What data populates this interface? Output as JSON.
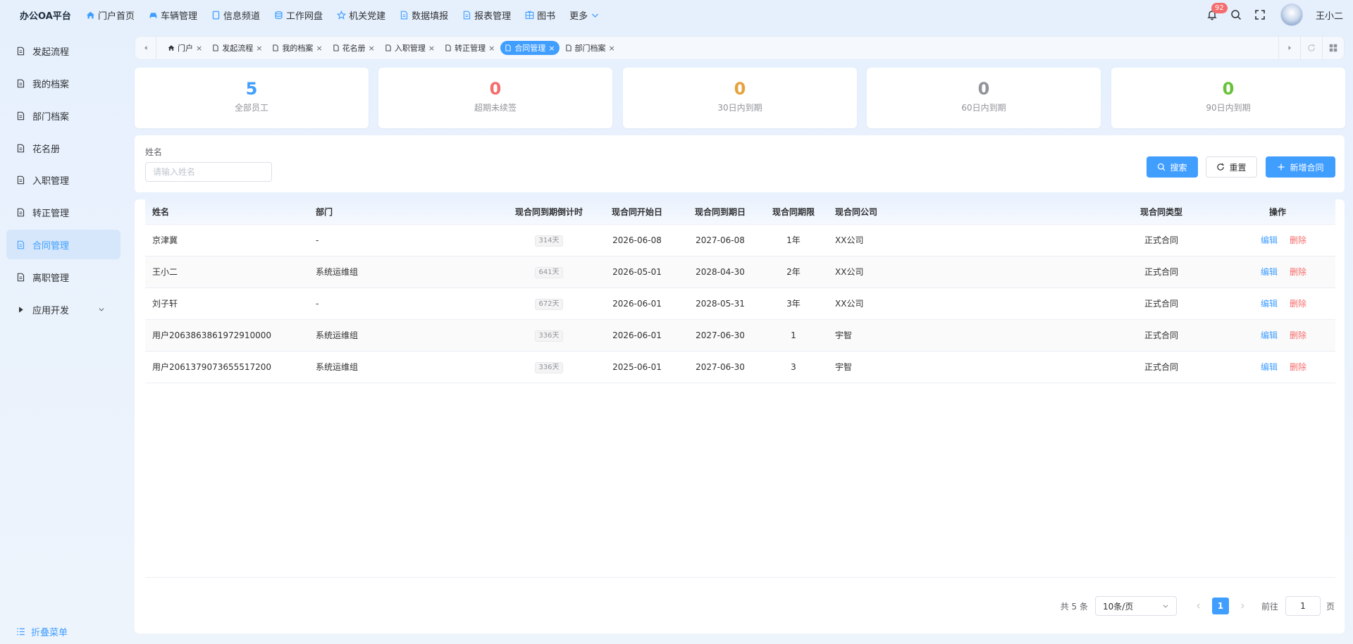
{
  "app": {
    "title": "办公OA平台"
  },
  "topnav": [
    {
      "label": "门户首页",
      "icon": "home-icon"
    },
    {
      "label": "车辆管理",
      "icon": "car-icon"
    },
    {
      "label": "信息频道",
      "icon": "tablet-icon"
    },
    {
      "label": "工作网盘",
      "icon": "database-icon"
    },
    {
      "label": "机关党建",
      "icon": "star-icon"
    },
    {
      "label": "数据填报",
      "icon": "document-icon"
    },
    {
      "label": "报表管理",
      "icon": "document-icon"
    },
    {
      "label": "图书",
      "icon": "grid-icon"
    },
    {
      "label": "更多",
      "icon": "chevron-down-icon"
    }
  ],
  "header": {
    "notification_count": "92",
    "username": "王小二"
  },
  "sidebar": {
    "items": [
      {
        "label": "发起流程",
        "icon": "document-icon"
      },
      {
        "label": "我的档案",
        "icon": "document-icon"
      },
      {
        "label": "部门档案",
        "icon": "document-icon"
      },
      {
        "label": "花名册",
        "icon": "document-icon"
      },
      {
        "label": "入职管理",
        "icon": "document-icon"
      },
      {
        "label": "转正管理",
        "icon": "document-icon"
      },
      {
        "label": "合同管理",
        "icon": "document-icon",
        "active": true
      },
      {
        "label": "离职管理",
        "icon": "document-icon"
      },
      {
        "label": "应用开发",
        "icon": "caret-right-icon"
      }
    ],
    "collapse_label": "折叠菜单"
  },
  "tabs": [
    {
      "label": "门户",
      "icon": "home-icon"
    },
    {
      "label": "发起流程",
      "icon": "document-icon"
    },
    {
      "label": "我的档案",
      "icon": "document-icon"
    },
    {
      "label": "花名册",
      "icon": "document-icon"
    },
    {
      "label": "入职管理",
      "icon": "document-icon"
    },
    {
      "label": "转正管理",
      "icon": "document-icon"
    },
    {
      "label": "合同管理",
      "icon": "document-icon",
      "active": true
    },
    {
      "label": "部门档案",
      "icon": "document-icon"
    }
  ],
  "stats": [
    {
      "value": "5",
      "label": "全部员工",
      "color": "#409eff"
    },
    {
      "value": "0",
      "label": "超期未续签",
      "color": "#f56c6c"
    },
    {
      "value": "0",
      "label": "30日内到期",
      "color": "#e6a23c"
    },
    {
      "value": "0",
      "label": "60日内到期",
      "color": "#909399"
    },
    {
      "value": "0",
      "label": "90日内到期",
      "color": "#67c23a"
    }
  ],
  "search": {
    "name_label": "姓名",
    "name_placeholder": "请输入姓名",
    "search_button": "搜索",
    "reset_button": "重置",
    "add_button": "新增合同"
  },
  "table": {
    "columns": [
      "姓名",
      "部门",
      "现合同到期倒计时",
      "现合同开始日",
      "现合同到期日",
      "现合同期限",
      "现合同公司",
      "现合同类型",
      "操作"
    ],
    "rows": [
      {
        "name": "京津冀",
        "dept": "-",
        "countdown": "314天",
        "start": "2026-06-08",
        "end": "2027-06-08",
        "term": "1年",
        "company": "XX公司",
        "type": "正式合同"
      },
      {
        "name": "王小二",
        "dept": "系统运维组",
        "countdown": "641天",
        "start": "2026-05-01",
        "end": "2028-04-30",
        "term": "2年",
        "company": "XX公司",
        "type": "正式合同"
      },
      {
        "name": "刘子轩",
        "dept": "-",
        "countdown": "672天",
        "start": "2026-06-01",
        "end": "2028-05-31",
        "term": "3年",
        "company": "XX公司",
        "type": "正式合同"
      },
      {
        "name": "用户2063863861972910000",
        "dept": "系统运维组",
        "countdown": "336天",
        "start": "2026-06-01",
        "end": "2027-06-30",
        "term": "1",
        "company": "宇智",
        "type": "正式合同"
      },
      {
        "name": "用户2061379073655517200",
        "dept": "系统运维组",
        "countdown": "336天",
        "start": "2025-06-01",
        "end": "2027-06-30",
        "term": "3",
        "company": "宇智",
        "type": "正式合同"
      }
    ],
    "edit_label": "编辑",
    "delete_label": "删除"
  },
  "pagination": {
    "total": "共 5 条",
    "page_size": "10条/页",
    "current_page": "1",
    "goto_label": "前往",
    "goto_value": "1",
    "page_suffix": "页"
  }
}
